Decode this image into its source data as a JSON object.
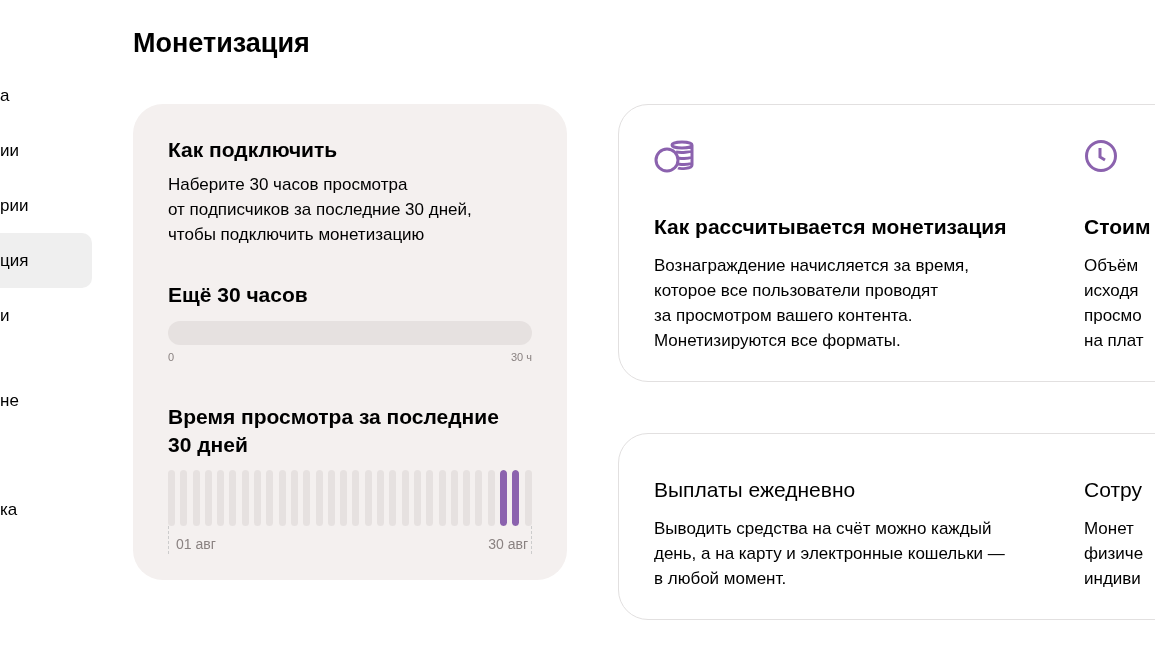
{
  "sidebar": {
    "groups": [
      {
        "items": [
          {
            "label": "а",
            "selected": false
          },
          {
            "label": "ии",
            "selected": false
          },
          {
            "label": "рии",
            "selected": false
          },
          {
            "label": "ция",
            "selected": true
          },
          {
            "label": "и",
            "selected": false
          }
        ]
      },
      {
        "items": [
          {
            "label": "не",
            "selected": false
          }
        ]
      },
      {
        "items": [
          {
            "label": "ка",
            "selected": false
          }
        ]
      }
    ]
  },
  "title": "Монетизация",
  "connect_card": {
    "title": "Как подключить",
    "text_lines": [
      "Наберите 30 часов просмотра",
      "от подписчиков за последние 30 дней,",
      "чтобы подключить монетизацию"
    ],
    "progress": {
      "title": "Ещё 30 часов",
      "level": 0,
      "min_label": "0",
      "max_label": "30 ч"
    },
    "history": {
      "title": "Время просмотра за последние 30 дней",
      "start_label": "01 авг",
      "end_label": "30 авг",
      "days": [
        {
          "level": 0
        },
        {
          "level": 0
        },
        {
          "level": 0
        },
        {
          "level": 0
        },
        {
          "level": 0
        },
        {
          "level": 0
        },
        {
          "level": 0
        },
        {
          "level": 0
        },
        {
          "level": 0
        },
        {
          "level": 0
        },
        {
          "level": 0
        },
        {
          "level": 0
        },
        {
          "level": 0
        },
        {
          "level": 0
        },
        {
          "level": 0
        },
        {
          "level": 0
        },
        {
          "level": 0
        },
        {
          "level": 0
        },
        {
          "level": 0
        },
        {
          "level": 0
        },
        {
          "level": 0
        },
        {
          "level": 0
        },
        {
          "level": 0
        },
        {
          "level": 0
        },
        {
          "level": 0
        },
        {
          "level": 0
        },
        {
          "level": 0
        },
        {
          "level": 1
        },
        {
          "level": 1
        },
        {
          "level": 0
        }
      ]
    }
  },
  "info_cards": [
    {
      "columns": [
        {
          "title": "Как рассчитывается монетизация",
          "text_lines": [
            "Вознаграждение начисляется за время,",
            "которое все пользователи проводят",
            "за просмотром вашего контента.",
            "Монетизируются все форматы."
          ]
        },
        {
          "title": "Стоим",
          "text_lines": [
            "Объём",
            "исходя",
            "просмо",
            "на плат"
          ]
        }
      ]
    },
    {
      "columns": [
        {
          "title": "Выплаты ежедневно",
          "text_lines": [
            "Выводить средства на счёт можно каждый",
            "день, а на карту и электронные кошельки —",
            "в любой момент."
          ]
        },
        {
          "title": "Сотру",
          "text_lines": [
            "Монет",
            "физиче",
            "индиви"
          ]
        }
      ]
    }
  ]
}
